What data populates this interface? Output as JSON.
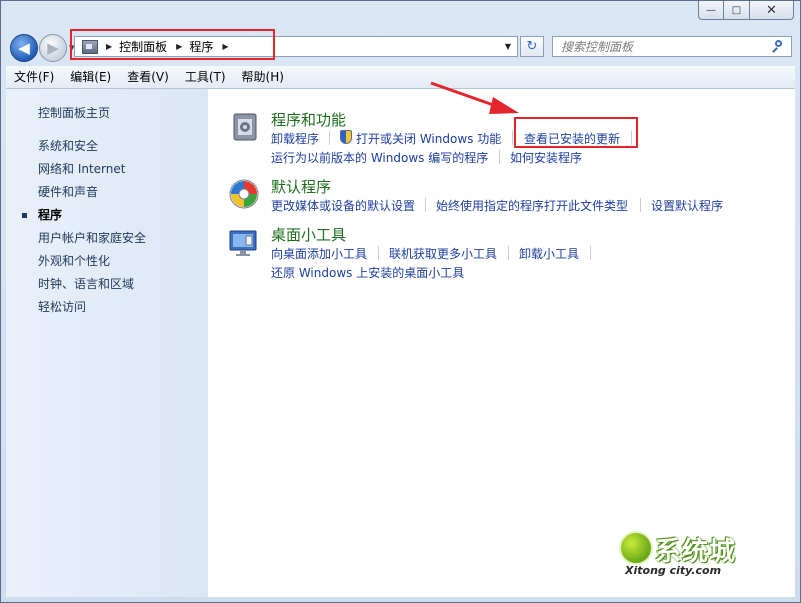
{
  "window": {
    "caption": {
      "minimize": "—",
      "maximize": "□",
      "close": "✕"
    }
  },
  "toolbar": {
    "back_glyph": "◀",
    "forward_glyph": "▶",
    "recent_glyph": "▼",
    "refresh_glyph": "↻"
  },
  "address": {
    "crumbs": [
      "控制面板",
      "程序"
    ],
    "sep": "▶",
    "dropdown": "▼"
  },
  "search": {
    "placeholder": "搜索控制面板"
  },
  "menu": [
    "文件(F)",
    "编辑(E)",
    "查看(V)",
    "工具(T)",
    "帮助(H)"
  ],
  "sidebar": {
    "home": "控制面板主页",
    "items": [
      "系统和安全",
      "网络和 Internet",
      "硬件和声音",
      "程序",
      "用户帐户和家庭安全",
      "外观和个性化",
      "时钟、语言和区域",
      "轻松访问"
    ],
    "current_index": 3
  },
  "categories": [
    {
      "title": "程序和功能",
      "icon": "programs-features-icon",
      "links": [
        "卸载程序",
        "打开或关闭 Windows 功能",
        "查看已安装的更新",
        "运行为以前版本的 Windows 编写的程序",
        "如何安装程序"
      ]
    },
    {
      "title": "默认程序",
      "icon": "default-programs-icon",
      "links": [
        "更改媒体或设备的默认设置",
        "始终使用指定的程序打开此文件类型",
        "设置默认程序"
      ]
    },
    {
      "title": "桌面小工具",
      "icon": "desktop-gadgets-icon",
      "links": [
        "向桌面添加小工具",
        "联机获取更多小工具",
        "卸载小工具",
        "还原 Windows 上安装的桌面小工具"
      ]
    }
  ],
  "annotation_color": "#e2252b",
  "watermark": {
    "brand": "系统城",
    "url": "Xitong city.com"
  }
}
